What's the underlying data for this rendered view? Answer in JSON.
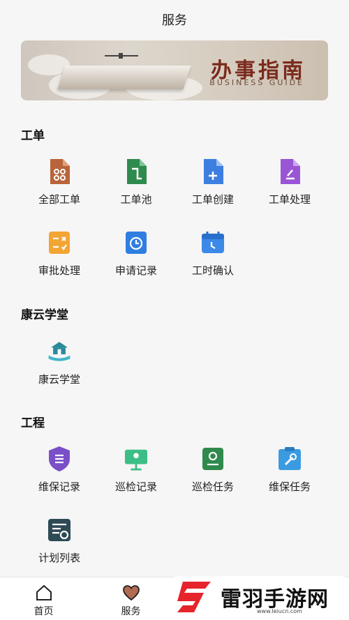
{
  "header": {
    "title": "服务"
  },
  "banner": {
    "title": "办事指南",
    "subtitle": "BUSINESS GUIDE"
  },
  "sections": {
    "workorder": {
      "title": "工单",
      "items": [
        {
          "label": "全部工单",
          "icon": "grid-document-icon",
          "color": "#b9643a"
        },
        {
          "label": "工单池",
          "icon": "document-copy-icon",
          "color": "#2f8a4d"
        },
        {
          "label": "工单创建",
          "icon": "document-add-icon",
          "color": "#3d7fe0"
        },
        {
          "label": "工单处理",
          "icon": "document-edit-icon",
          "color": "#9a55d6"
        },
        {
          "label": "审批处理",
          "icon": "approval-icon",
          "color": "#f3a534"
        },
        {
          "label": "申请记录",
          "icon": "clock-record-icon",
          "color": "#2f7fe0"
        },
        {
          "label": "工时确认",
          "icon": "calendar-clock-icon",
          "color": "#3c8ae8"
        }
      ]
    },
    "academy": {
      "title": "康云学堂",
      "items": [
        {
          "label": "康云学堂",
          "icon": "school-book-icon",
          "color": "#2a8a9a"
        }
      ]
    },
    "engineering": {
      "title": "工程",
      "items": [
        {
          "label": "维保记录",
          "icon": "shield-list-icon",
          "color": "#7a4fc8"
        },
        {
          "label": "巡检记录",
          "icon": "map-pin-board-icon",
          "color": "#3cbf86"
        },
        {
          "label": "巡检任务",
          "icon": "location-task-icon",
          "color": "#2f8a4d"
        },
        {
          "label": "维保任务",
          "icon": "wrench-clipboard-icon",
          "color": "#3c9be0"
        },
        {
          "label": "计划列表",
          "icon": "plan-list-icon",
          "color": "#2e4a55"
        }
      ]
    }
  },
  "tabbar": [
    {
      "label": "首页",
      "icon": "home-icon"
    },
    {
      "label": "服务",
      "icon": "heart-icon"
    }
  ],
  "watermark": {
    "text": "雷羽手游网",
    "url": "www.leiucn.com"
  }
}
